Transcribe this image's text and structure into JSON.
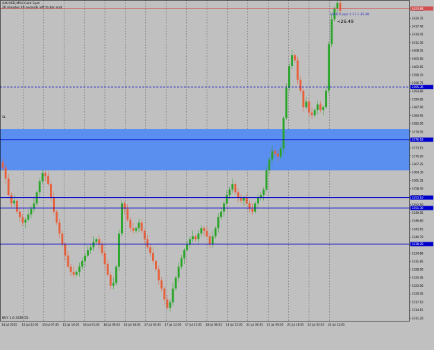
{
  "header": {
    "symbol_line": "XAUUSD,M5H  Gold Spot",
    "timer_line": "26 minutes 49 seconds left to bar end"
  },
  "bid_info": "1908.0 pips 1.31 1.35.48",
  "countdown": "<26:49",
  "sl_label": "SL",
  "footer_label": "BUY 1.6 3339.55",
  "colors": {
    "background": "#c0c0c0",
    "bull": "#2aa52a",
    "bear": "#e8603a",
    "zone": "#5b8fef",
    "level_line": "#0000cc",
    "bid_line": "#d05050",
    "grid": "#606060"
  },
  "price_axis": {
    "min": 3310,
    "max": 3427,
    "ticks": [
      "3423.30",
      "3420.35",
      "3417.40",
      "3414.45",
      "3411.50",
      "3408.55",
      "3405.60",
      "3402.65",
      "3399.70",
      "3396.75",
      "3393.80",
      "3390.85",
      "3387.90",
      "3384.95",
      "3382.00",
      "3379.05",
      "3376.10",
      "3373.15",
      "3370.20",
      "3367.25",
      "3364.30",
      "3361.35",
      "3358.40",
      "3355.45",
      "3352.50",
      "3349.55",
      "3346.60",
      "3343.65",
      "3340.70",
      "3337.75",
      "3334.80",
      "3331.85",
      "3328.90",
      "3325.95",
      "3323.00",
      "3320.05",
      "3317.10",
      "3314.15",
      "3311.20"
    ],
    "tags": [
      {
        "price": 3423.88,
        "text": "3423.88",
        "color": "#d05050"
      },
      {
        "price": 3395.36,
        "text": "3395.36",
        "color": "#0000cc"
      },
      {
        "price": 3376.18,
        "text": "3376.18",
        "color": "#0000cc"
      },
      {
        "price": 3355.1,
        "text": "3355.10",
        "color": "#0000cc"
      },
      {
        "price": 3351.3,
        "text": "3351.30",
        "color": "#0000cc"
      },
      {
        "price": 3338.2,
        "text": "3338.20",
        "color": "#0000cc"
      }
    ]
  },
  "time_axis": {
    "labels": [
      "14 Jul 2025",
      "15 Jul 22:05",
      "15 Jul 07:05",
      "15 Jul 16:05",
      "16 Jul 01:05",
      "16 Jul 09:05",
      "16 Jul 18:05",
      "17 Jul 03:05",
      "17 Jul 12:05",
      "17 Jul 21:05",
      "18 Jul 06:05",
      "18 Jul 15:05",
      "21 Jul 00:05",
      "21 Jul 09:05",
      "21 Jul 18:05",
      "22 Jul 03:05",
      "22 Jul 12:05"
    ]
  },
  "chart_data": {
    "type": "candlestick",
    "instrument": "XAUUSD",
    "zone": {
      "from": 3365,
      "to": 3380
    },
    "levels": [
      3395.36,
      3376.18,
      3355.1,
      3351.3,
      3338.2
    ],
    "bid": 3423.88,
    "closes": [
      3366,
      3362,
      3356,
      3353,
      3354,
      3350,
      3348,
      3346,
      3347,
      3349,
      3351,
      3353,
      3357,
      3361,
      3364,
      3363,
      3360,
      3355,
      3350,
      3346,
      3342,
      3338,
      3334,
      3330,
      3328,
      3327,
      3328,
      3330,
      3332,
      3334,
      3336,
      3337,
      3339,
      3340,
      3338,
      3335,
      3331,
      3327,
      3323,
      3324,
      3330,
      3342,
      3353,
      3351,
      3347,
      3344,
      3343,
      3344,
      3346,
      3343,
      3340,
      3337,
      3335,
      3332,
      3329,
      3325,
      3322,
      3318,
      3315,
      3317,
      3322,
      3326,
      3330,
      3333,
      3336,
      3338,
      3340,
      3341,
      3340,
      3342,
      3344,
      3343,
      3341,
      3338,
      3341,
      3344,
      3348,
      3350,
      3353,
      3356,
      3358,
      3360,
      3357,
      3355,
      3354,
      3355,
      3353,
      3351,
      3350,
      3353,
      3355,
      3356,
      3358,
      3365,
      3369,
      3372,
      3371,
      3370,
      3373,
      3384,
      3395,
      3403,
      3407,
      3405,
      3398,
      3394,
      3388,
      3390,
      3386,
      3385,
      3387,
      3389,
      3387,
      3388,
      3394,
      3411,
      3420,
      3424,
      3426,
      3423
    ]
  }
}
